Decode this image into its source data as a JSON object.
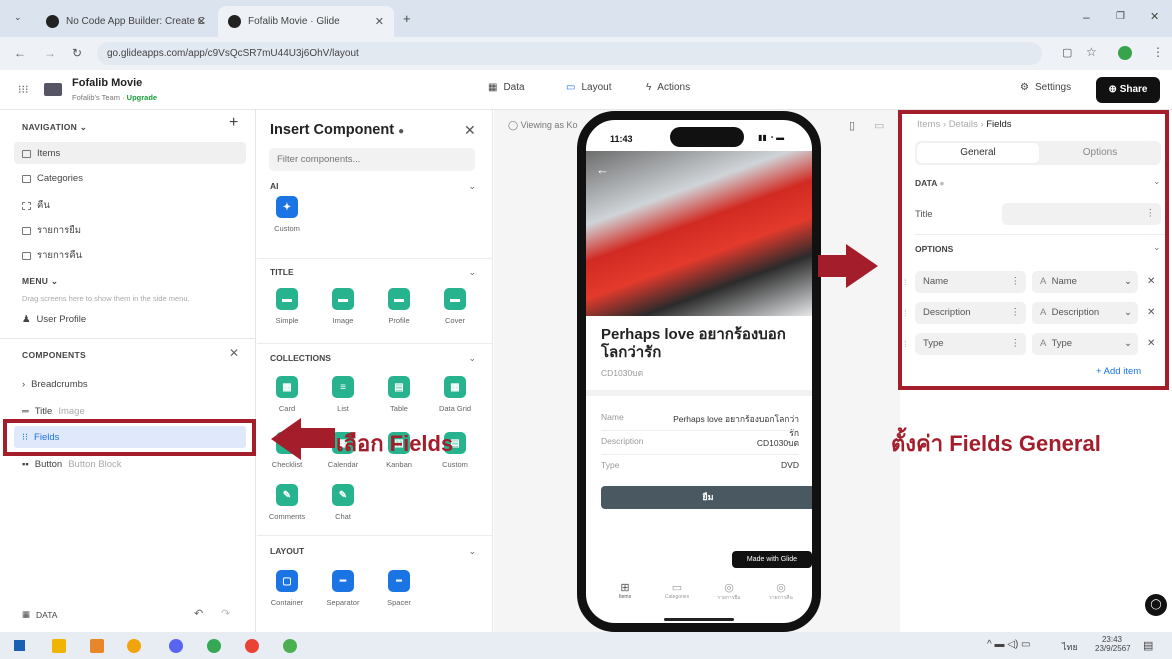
{
  "browser": {
    "tabs": [
      {
        "title": "No Code App Builder: Create C"
      },
      {
        "title": "Fofalib Movie · Glide"
      }
    ],
    "new_tab": "+",
    "url": "go.glideapps.com/app/c9VsQcSR7mU44U3j6OhV/layout"
  },
  "app": {
    "name": "Fofalib Movie",
    "team": "Fofalib's Team",
    "upgrade": "Upgrade",
    "nav": {
      "data": "Data",
      "layout": "Layout",
      "actions": "Actions"
    },
    "settings": "Settings",
    "share": "Share"
  },
  "left": {
    "navigation_title": "NAVIGATION",
    "nav_items": [
      "Items",
      "Categories",
      "คืน",
      "รายการยืม",
      "รายการคืน"
    ],
    "menu_title": "MENU",
    "menu_hint": "Drag screens here to show them in the side menu.",
    "menu_items": [
      "User Profile"
    ],
    "components_title": "COMPONENTS",
    "components": [
      {
        "label": "Breadcrumbs",
        "sub": ""
      },
      {
        "label": "Title",
        "sub": "Image"
      },
      {
        "label": "Fields",
        "sub": ""
      },
      {
        "label": "Button",
        "sub": "Button Block"
      }
    ],
    "data_label": "DATA"
  },
  "insert": {
    "title": "Insert Component",
    "filter_placeholder": "Filter components...",
    "sections": [
      {
        "name": "AI",
        "items": [
          "Custom"
        ]
      },
      {
        "name": "TITLE",
        "items": [
          "Simple",
          "Image",
          "Profile",
          "Cover"
        ]
      },
      {
        "name": "COLLECTIONS",
        "items": [
          "Card",
          "List",
          "Table",
          "Data Grid",
          "Checklist",
          "Calendar",
          "Kanban",
          "Custom",
          "Comments",
          "Chat"
        ]
      },
      {
        "name": "LAYOUT",
        "items": [
          "Container",
          "Separator",
          "Spacer"
        ]
      }
    ]
  },
  "canvas": {
    "viewing_as": "Viewing as Ko"
  },
  "phone": {
    "time": "11:43",
    "title": "Perhaps love อยากร้องบอกโลกว่ารัก",
    "subtitle": "CD1030บต",
    "fields": [
      {
        "label": "Name",
        "value": "Perhaps love อยากร้องบอกโลกว่ารัก"
      },
      {
        "label": "Description",
        "value": "CD1030บต"
      },
      {
        "label": "Type",
        "value": "DVD"
      }
    ],
    "button": "ยืม",
    "made_with": "Made with Glide",
    "tabs": [
      "Items",
      "Categories",
      "รายการยืม",
      "รายการคืน"
    ]
  },
  "right": {
    "breadcrumb": [
      "Items",
      "Details",
      "Fields"
    ],
    "tabs": {
      "general": "General",
      "options": "Options"
    },
    "data_title": "DATA",
    "title_label": "Title",
    "options_title": "OPTIONS",
    "options": [
      {
        "name": "Name",
        "value": "Name"
      },
      {
        "name": "Description",
        "value": "Description"
      },
      {
        "name": "Type",
        "value": "Type"
      }
    ],
    "type_glyph": "A",
    "add_item": "+ Add item"
  },
  "annotations": {
    "left_callout": "เลือก Fields",
    "right_callout": "ตั้งค่า Fields General"
  },
  "taskbar": {
    "lang": "ไทย",
    "time": "23:43",
    "date": "23/9/2567"
  },
  "colors": {
    "highlight": "#a31d2b",
    "accent": "#1b74e4",
    "green": "#26b38e"
  }
}
